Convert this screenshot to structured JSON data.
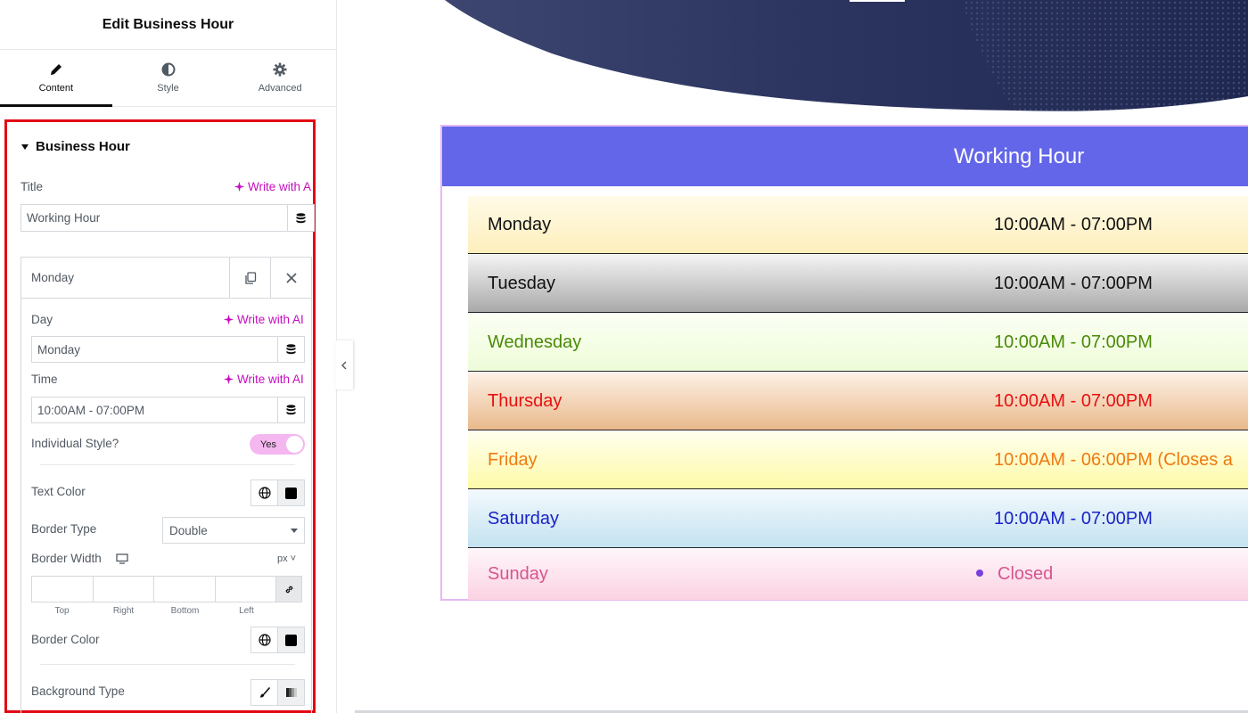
{
  "panel": {
    "title": "Edit Business Hour",
    "tabs": [
      {
        "label": "Content",
        "icon": "pencil-icon",
        "active": true
      },
      {
        "label": "Style",
        "icon": "half-circle-icon",
        "active": false
      },
      {
        "label": "Advanced",
        "icon": "gear-icon",
        "active": false
      }
    ],
    "section_title": "Business Hour",
    "title_label": "Title",
    "write_ai": "Write with AI",
    "write_ai_cut": "Write with A",
    "title_value": "Working Hour",
    "item": {
      "name": "Monday",
      "day_label": "Day",
      "day_value": "Monday",
      "time_label": "Time",
      "time_value": "10:00AM - 07:00PM",
      "individual_style_label": "Individual Style?",
      "individual_style_value": "Yes",
      "text_color_label": "Text Color",
      "border_type_label": "Border Type",
      "border_type_value": "Double",
      "border_width_label": "Border Width",
      "unit": "px",
      "dims": [
        "Top",
        "Right",
        "Bottom",
        "Left"
      ],
      "border_color_label": "Border Color",
      "background_type_label": "Background Type"
    },
    "accent_color": "#c50ebf",
    "highlight_color": "#e30613"
  },
  "widget": {
    "title": "Working Hour",
    "header_color": "#6366e8",
    "rows": [
      {
        "day": "Monday",
        "time": "10:00AM - 07:00PM",
        "color": "#111111",
        "bg_from": "#fffbe8",
        "bg_to": "#fdeebb"
      },
      {
        "day": "Tuesday",
        "time": "10:00AM - 07:00PM",
        "color": "#111111",
        "bg_from": "#f4f4f4",
        "bg_to": "#a9a9a9"
      },
      {
        "day": "Wednesday",
        "time": "10:00AM - 07:00PM",
        "color": "#4a8a08",
        "bg_from": "#fbfff4",
        "bg_to": "#eefcd9"
      },
      {
        "day": "Thursday",
        "time": "10:00AM - 07:00PM",
        "color": "#e81010",
        "bg_from": "#fdf1e6",
        "bg_to": "#e9b98c"
      },
      {
        "day": "Friday",
        "time": "10:00AM - 06:00PM (Closes a",
        "color": "#f07a10",
        "bg_from": "#ffffee",
        "bg_to": "#fdfaa8"
      },
      {
        "day": "Saturday",
        "time": "10:00AM - 07:00PM",
        "color": "#1a24c8",
        "bg_from": "#f2f9fd",
        "bg_to": "#c4e2f0"
      },
      {
        "day": "Sunday",
        "time": "Closed",
        "color": "#d6568f",
        "bg_from": "#fff6fa",
        "bg_to": "#fbd2e2",
        "bullet": true
      }
    ]
  }
}
